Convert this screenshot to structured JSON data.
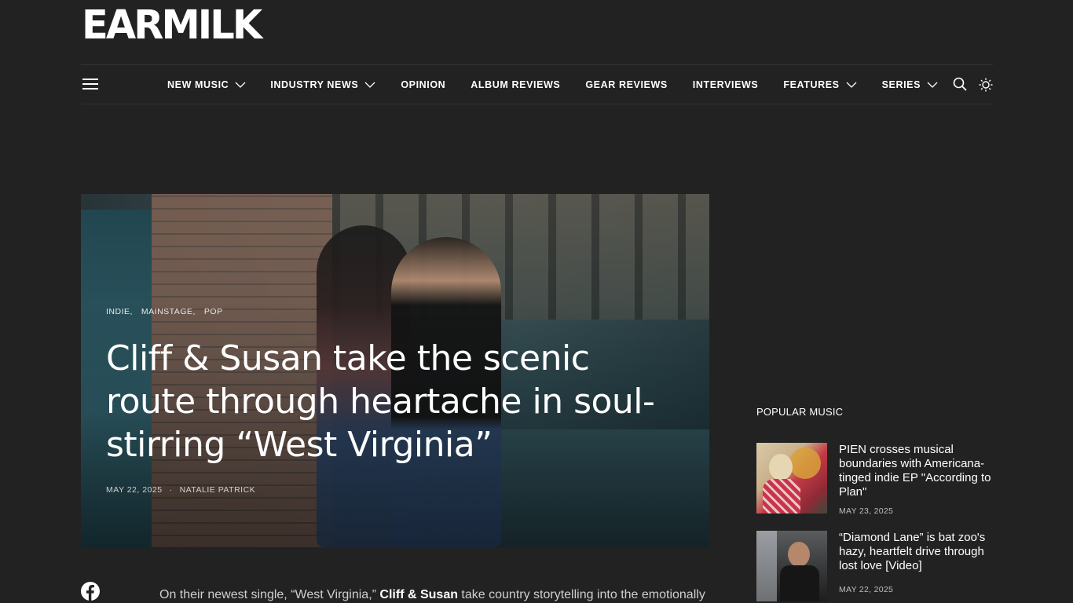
{
  "brand": {
    "logo_text": "EARMILK"
  },
  "nav": {
    "items": [
      {
        "label": "NEW MUSIC",
        "dropdown": true
      },
      {
        "label": "INDUSTRY NEWS",
        "dropdown": true
      },
      {
        "label": "OPINION",
        "dropdown": false
      },
      {
        "label": "ALBUM REVIEWS",
        "dropdown": false
      },
      {
        "label": "GEAR REVIEWS",
        "dropdown": false
      },
      {
        "label": "INTERVIEWS",
        "dropdown": false
      },
      {
        "label": "FEATURES",
        "dropdown": true
      },
      {
        "label": "SERIES",
        "dropdown": true
      }
    ],
    "icons": {
      "menu": "hamburger-menu-icon",
      "search": "search-icon",
      "theme": "sun-icon"
    }
  },
  "hero": {
    "categories": [
      "INDIE,",
      "MAINSTAGE,",
      "POP"
    ],
    "title": "Cliff & Susan take the scenic route through heartache in soul-stirring “West Virginia”",
    "date": "MAY 22, 2025",
    "separator": "·",
    "author": "NATALIE PATRICK"
  },
  "article": {
    "intro_lead": "On their newest single, “West Virginia,” ",
    "intro_artist": "Cliff & Susan",
    "intro_tail": " take country storytelling into the emotionally",
    "share_icon": "facebook-icon"
  },
  "sidebar": {
    "title": "POPULAR MUSIC",
    "items": [
      {
        "title": "PIEN crosses musical boundaries with Americana-tinged indie EP \"According to Plan\"",
        "date": "MAY 23, 2025"
      },
      {
        "title": "“Diamond Lane” is bat zoo's hazy, heartfelt drive through lost love [Video]",
        "date": "MAY 22, 2025"
      }
    ]
  },
  "colors": {
    "background": "#222222",
    "text": "#ffffff",
    "muted": "#bdbdbd"
  }
}
